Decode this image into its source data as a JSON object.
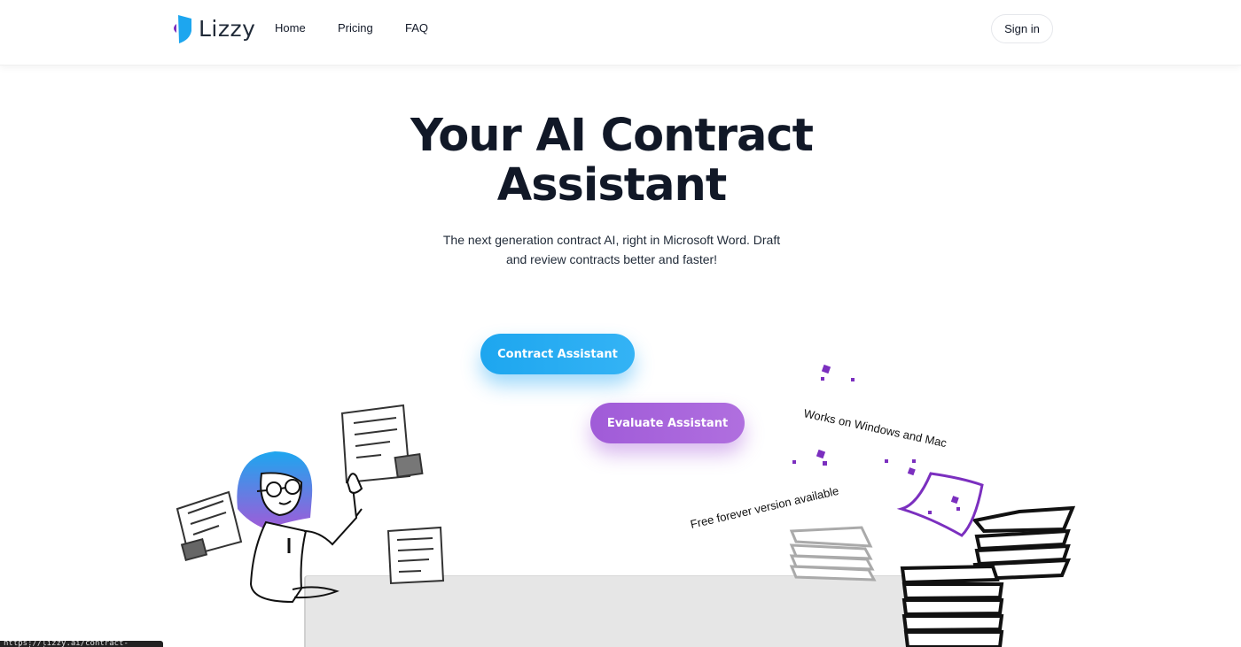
{
  "brand": {
    "name": "Lizzy",
    "accent_blue": "#1da6ef",
    "accent_purple": "#7b2fbf"
  },
  "nav": {
    "links": [
      {
        "label": "Home"
      },
      {
        "label": "Pricing"
      },
      {
        "label": "FAQ"
      }
    ],
    "signin_label": "Sign in"
  },
  "hero": {
    "title_line1": "Your AI Contract",
    "title_line2": "Assistant",
    "subtitle_line1": "The next generation contract AI, right in Microsoft Word. Draft",
    "subtitle_line2": "and review contracts better and faster!"
  },
  "buttons": {
    "contract_assistant": "Contract Assistant",
    "evaluate_assistant": "Evaluate Assistant"
  },
  "illustration": {
    "caption_platforms": "Works on Windows and Mac",
    "caption_free": "Free forever version available"
  },
  "status_bar": {
    "url": "https://lizzy.ai/contract-assistant"
  },
  "icons": [
    "lizzy-logo-icon"
  ]
}
